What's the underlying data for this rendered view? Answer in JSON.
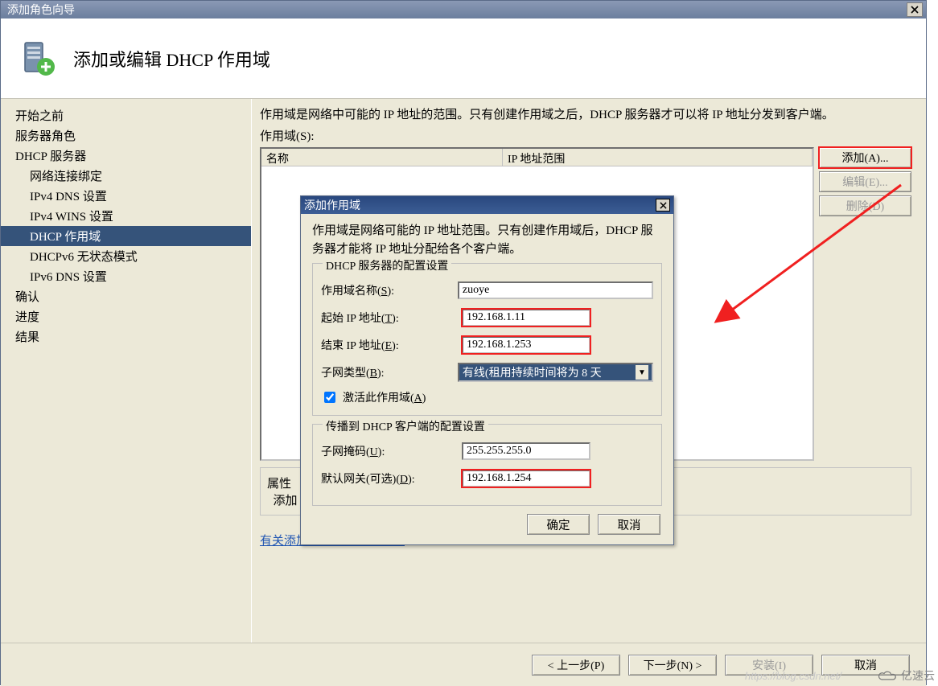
{
  "window": {
    "title": "添加角色向导",
    "close_x": "X"
  },
  "header": {
    "title": "添加或编辑 DHCP 作用域"
  },
  "sidebar": {
    "items": [
      "开始之前",
      "服务器角色",
      "DHCP 服务器",
      "网络连接绑定",
      "IPv4 DNS 设置",
      "IPv4 WINS 设置",
      "DHCP 作用域",
      "DHCPv6 无状态模式",
      "IPv6 DNS 设置",
      "确认",
      "进度",
      "结果"
    ],
    "selected_index": 6
  },
  "main": {
    "description": "作用域是网络中可能的 IP 地址的范围。只有创建作用域之后，DHCP 服务器才可以将 IP 地址分发到客户端。",
    "scope_label": "作用域(S):",
    "columns": {
      "name": "名称",
      "range": "IP 地址范围"
    },
    "buttons": {
      "add": "添加(A)...",
      "edit": "编辑(E)...",
      "delete": "删除(D)"
    },
    "props_label": "属性",
    "props_sub": "添加",
    "more_link": "有关添加作用域的详细信息"
  },
  "footer": {
    "prev": "< 上一步(P)",
    "next": "下一步(N) >",
    "install": "安装(I)",
    "cancel": "取消"
  },
  "dialog": {
    "title": "添加作用域",
    "close_x": "X",
    "description": "作用域是网络可能的 IP 地址范围。只有创建作用域后，DHCP 服务器才能将 IP 地址分配给各个客户端。",
    "fieldset1_legend": "DHCP 服务器的配置设置",
    "labels": {
      "scope_name": "作用域名称(S):",
      "start_ip": "起始 IP 地址(T):",
      "end_ip": "结束 IP 地址(E):",
      "subnet_type": "子网类型(B):",
      "activate": "激活此作用域(A)"
    },
    "values": {
      "scope_name": "zuoye",
      "start_ip": "192.168.1.11",
      "end_ip": "192.168.1.253",
      "subnet_type": "有线(租用持续时间将为 8 天",
      "activate_checked": true
    },
    "fieldset2_legend": "传播到 DHCP 客户端的配置设置",
    "labels2": {
      "subnet_mask": "子网掩码(U):",
      "default_gw": "默认网关(可选)(D):"
    },
    "values2": {
      "subnet_mask": "255.255.255.0",
      "default_gw": "192.168.1.254"
    },
    "buttons": {
      "ok": "确定",
      "cancel": "取消"
    }
  },
  "watermark": {
    "blog": "https://blog.csdn.net/",
    "brand": "亿速云"
  }
}
